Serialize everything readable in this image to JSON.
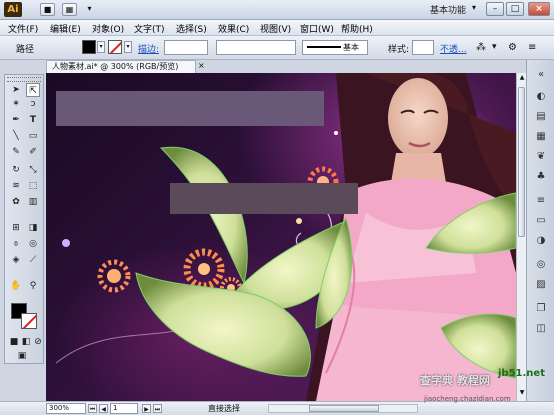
{
  "titlebar": {
    "logo": "Ai",
    "workspace": "基本功能",
    "colors": {
      "accent": "#f5b040",
      "close": "#c24b36"
    }
  },
  "menu": [
    "文件(F)",
    "编辑(E)",
    "对象(O)",
    "文字(T)",
    "选择(S)",
    "效果(C)",
    "视图(V)",
    "窗口(W)",
    "帮助(H)"
  ],
  "control": {
    "object_type": "路径",
    "stroke_label": "描边:",
    "brush_name": "基本",
    "style_label": "样式:",
    "opacity_label": "不透..."
  },
  "document": {
    "tab_title": "人物素材.ai* @ 300% (RGB/预览)",
    "close": "×"
  },
  "status": {
    "zoom": "300%",
    "page": "1",
    "tool": "直接选择"
  },
  "watermark": {
    "line1": "查字典 教程网",
    "line2": "jiaocheng.chazidian.com",
    "site": "jb51.net"
  },
  "icons": [
    "selection-icon",
    "direct-selection-icon",
    "magic-wand-icon",
    "lasso-icon",
    "pen-icon",
    "type-icon",
    "line-icon",
    "rectangle-icon",
    "paintbrush-icon",
    "pencil-icon",
    "rotate-icon",
    "scale-icon",
    "warp-icon",
    "free-transform-icon",
    "symbol-sprayer-icon",
    "graph-icon",
    "mesh-icon",
    "gradient-icon",
    "eyedropper-icon",
    "blend-icon",
    "live-paint-icon",
    "slice-icon",
    "hand-icon",
    "zoom-icon"
  ]
}
